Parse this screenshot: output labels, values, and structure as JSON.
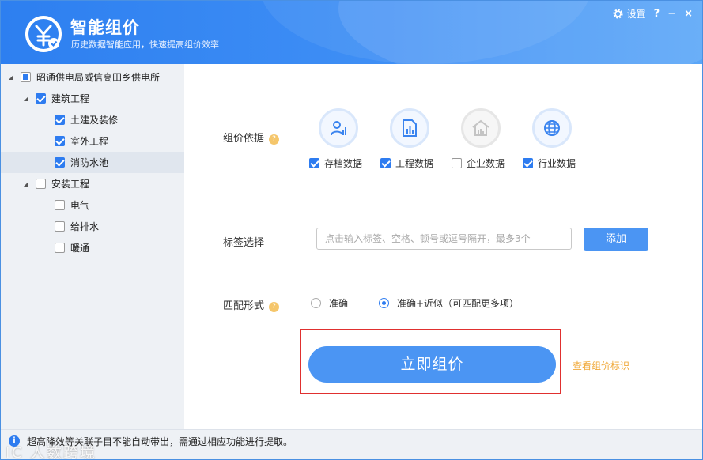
{
  "header": {
    "title": "智能组价",
    "subtitle": "历史数据智能应用，快速提高组价效率",
    "settings_label": "设置",
    "help_symbol": "?",
    "minimize_symbol": "−",
    "close_symbol": "×"
  },
  "tree": {
    "root": {
      "label": "昭通供电局威信高田乡供电所",
      "state": "partial"
    },
    "groups": [
      {
        "label": "建筑工程",
        "checked": true,
        "children": [
          {
            "label": "土建及装修",
            "checked": true
          },
          {
            "label": "室外工程",
            "checked": true
          },
          {
            "label": "消防水池",
            "checked": true,
            "selected": true
          }
        ]
      },
      {
        "label": "安装工程",
        "checked": false,
        "children": [
          {
            "label": "电气",
            "checked": false
          },
          {
            "label": "给排水",
            "checked": false
          },
          {
            "label": "暖通",
            "checked": false
          }
        ]
      }
    ]
  },
  "pricing_basis": {
    "label": "组价依据",
    "help_symbol": "?",
    "sources": [
      {
        "label": "存档数据",
        "icon": "archive-user-icon",
        "checked": true
      },
      {
        "label": "工程数据",
        "icon": "project-document-icon",
        "checked": true
      },
      {
        "label": "企业数据",
        "icon": "enterprise-building-icon",
        "checked": false
      },
      {
        "label": "行业数据",
        "icon": "industry-globe-icon",
        "checked": true
      }
    ]
  },
  "tag_select": {
    "label": "标签选择",
    "placeholder": "点击输入标签、空格、顿号或逗号隔开，最多3个",
    "add_label": "添加"
  },
  "match_mode": {
    "label": "匹配形式",
    "help_symbol": "?",
    "options": [
      {
        "label": "准确",
        "selected": false
      },
      {
        "label": "准确+近似（可匹配更多项）",
        "selected": true
      }
    ]
  },
  "actions": {
    "price_now": "立即组价",
    "view_marks": "查看组价标识"
  },
  "status": {
    "icon_symbol": "i",
    "text": "超高降效等关联子目不能自动带出，需通过相应功能进行提取。"
  },
  "watermark": {
    "text": "IC 人数跨境"
  },
  "colors": {
    "primary": "#2e7cf0",
    "button": "#4b95f3",
    "highlight": "#e0302f",
    "link": "#f0a93a"
  }
}
